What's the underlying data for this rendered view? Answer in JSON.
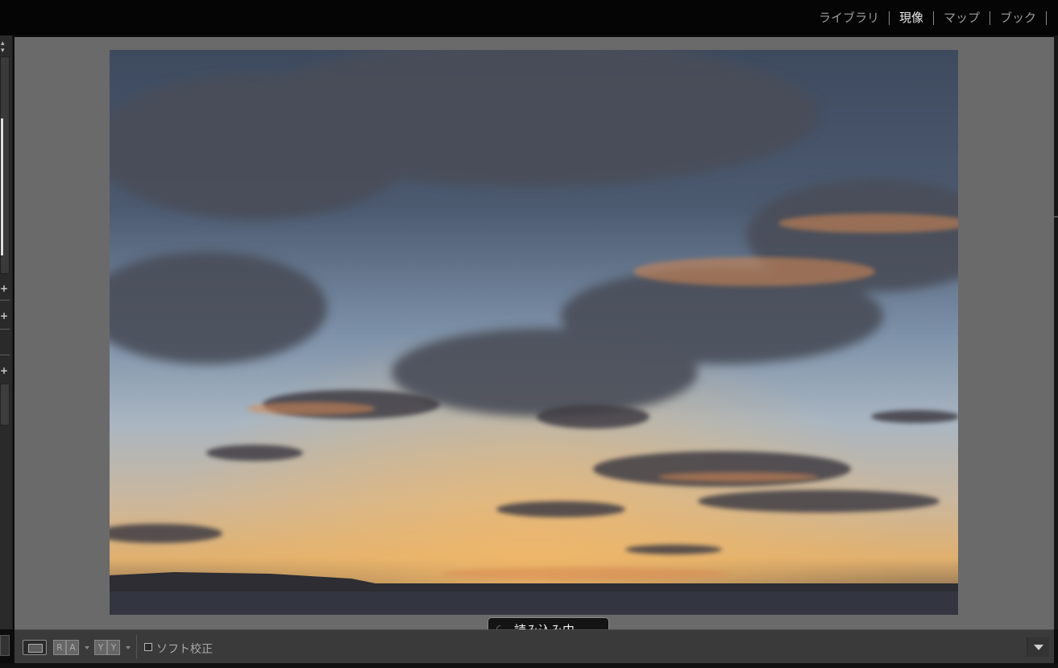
{
  "modules": [
    {
      "label": "ライブラリ",
      "active": false
    },
    {
      "label": "現像",
      "active": true
    },
    {
      "label": "マップ",
      "active": false
    },
    {
      "label": "ブック",
      "active": false
    }
  ],
  "photo": {
    "subject": "夕焼け空と雲、海と島影"
  },
  "loading": {
    "text": "読み込み中..."
  },
  "toolbar": {
    "view_mode_icon": "loupe-view-icon",
    "before_after_labels": [
      "R",
      "A"
    ],
    "before_after_y_labels": [
      "Y",
      "Y"
    ],
    "soft_proof_label": "ソフト校正",
    "soft_proof_checked": false
  },
  "colors": {
    "canvas_bg": "#6a6a6a",
    "top_bar": "#050505",
    "toolbar_bg": "#3a3a3a",
    "active_module": "#ececec",
    "inactive_module": "#9a9a9a"
  }
}
